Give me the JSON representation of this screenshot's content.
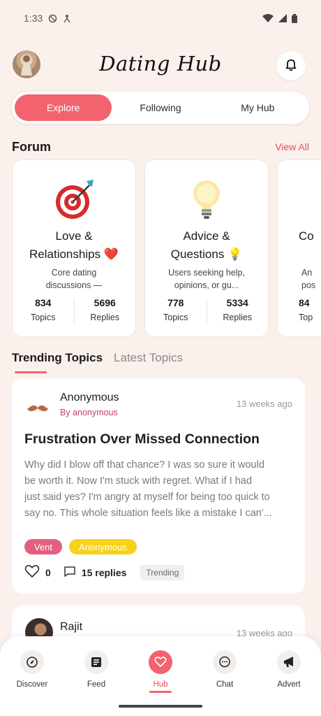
{
  "status_bar": {
    "time": "1:33"
  },
  "header": {
    "title": "Dating Hub"
  },
  "segments": [
    {
      "label": "Explore",
      "active": true
    },
    {
      "label": "Following",
      "active": false
    },
    {
      "label": "My Hub",
      "active": false
    }
  ],
  "forum": {
    "title": "Forum",
    "view_all": "View All",
    "cards": [
      {
        "icon": "target-icon",
        "title_line1": "Love &",
        "title_line2": "Relationships ❤️",
        "desc_line1": "Core dating",
        "desc_line2": "discussions —",
        "topics": "834",
        "topics_label": "Topics",
        "replies": "5696",
        "replies_label": "Replies"
      },
      {
        "icon": "lightbulb-icon",
        "title_line1": "Advice &",
        "title_line2": "Questions 💡",
        "desc_line1": "Users seeking help,",
        "desc_line2": "opinions, or gu...",
        "topics": "778",
        "topics_label": "Topics",
        "replies": "5334",
        "replies_label": "Replies"
      },
      {
        "title_line1": "",
        "title_line2": "Co",
        "desc_line1": "An",
        "desc_line2": "pos",
        "topics": "84",
        "topics_label": "Top"
      }
    ]
  },
  "topic_tabs": [
    {
      "label": "Trending Topics",
      "active": true
    },
    {
      "label": "Latest Topics",
      "active": false
    }
  ],
  "posts": [
    {
      "author": "Anonymous",
      "by": "By anonymous",
      "time": "13 weeks ago",
      "title": "Frustration Over Missed Connection",
      "body_lines": [
        "Why did I blow off that chance? I was so sure it would",
        "be worth it. Now I'm stuck with regret. What if I had",
        "just said yes? I'm angry at myself for being too quick to",
        "say no. This whole situation feels like a mistake I can'..."
      ],
      "tags": [
        "Vent",
        "Anonymous"
      ],
      "likes": "0",
      "replies": "15 replies",
      "badge": "Trending"
    },
    {
      "author": "Rajit",
      "time": "13 weeks ago"
    }
  ],
  "bottom_nav": [
    {
      "label": "Discover",
      "icon": "compass-icon"
    },
    {
      "label": "Feed",
      "icon": "feed-icon"
    },
    {
      "label": "Hub",
      "icon": "heart-icon",
      "active": true
    },
    {
      "label": "Chat",
      "icon": "chat-bubble-icon"
    },
    {
      "label": "Advert",
      "icon": "megaphone-icon"
    }
  ],
  "colors": {
    "accent": "#f2636e",
    "background": "#faf1ec",
    "vent_tag": "#e35f7f",
    "anon_tag": "#f7d21b"
  }
}
